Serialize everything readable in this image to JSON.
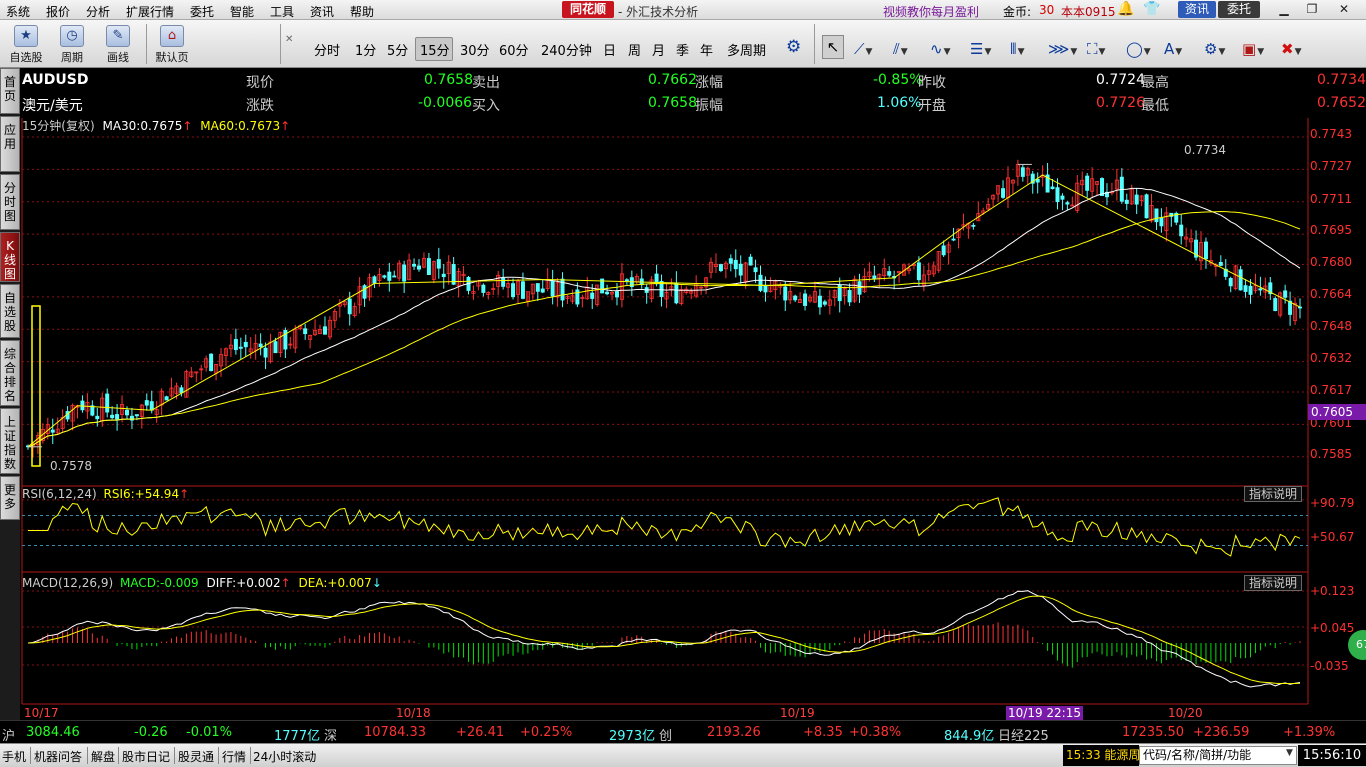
{
  "menu": [
    "系统",
    "报价",
    "分析",
    "扩展行情",
    "委托",
    "智能",
    "工具",
    "资讯",
    "帮助"
  ],
  "app": {
    "brand": "同花顺",
    "title": "- 外汇技术分析",
    "promo": "视频教你每月盈利",
    "coins_label": "金币:",
    "coins_value": "30",
    "version": "本本0915"
  },
  "top_buttons": {
    "news": "资讯",
    "trade": "委托"
  },
  "toolbar": {
    "self_select": "自选股",
    "cycle": "周期",
    "draw": "画线",
    "default_page": "默认页",
    "periods": [
      "分时",
      "1分",
      "5分",
      "15分",
      "30分",
      "60分",
      "240分钟",
      "日",
      "周",
      "月",
      "季",
      "年",
      "多周期"
    ],
    "active_period": "15分"
  },
  "sidebar": {
    "tabs": [
      "首页",
      "应用",
      "分时图",
      "K线图",
      "自选股",
      "综合排名",
      "上证指数",
      "更多"
    ],
    "active": "K线图"
  },
  "quote": {
    "symbol": "AUDUSD",
    "name": "澳元/美元",
    "now_label": "现价",
    "now": "0.7658",
    "change_label": "涨跌",
    "change": "-0.0066",
    "sell_label": "卖出",
    "sell": "0.7662",
    "buy_label": "买入",
    "buy": "0.7658",
    "pct_label": "涨幅",
    "pct": "-0.85%",
    "amp_label": "振幅",
    "amp": "1.06%",
    "prev_label": "昨收",
    "prev": "0.7724",
    "open_label": "开盘",
    "open": "0.7726",
    "high_label": "最高",
    "high": "0.7734",
    "low_label": "最低",
    "low": "0.7652"
  },
  "ma_line": {
    "period": "15分钟(复权)",
    "ma30_label": "MA30:",
    "ma30": "0.7675",
    "ma60_label": "MA60:",
    "ma60": "0.7673"
  },
  "rsi": {
    "label": "RSI(6,12,24)",
    "rsi6_label": "RSI6:",
    "rsi6": "+54.94",
    "explain": "指标说明",
    "levels": [
      "+90.79",
      "+50.67"
    ]
  },
  "macd": {
    "label": "MACD(12,26,9)",
    "macd_label": "MACD:",
    "macd": "-0.009",
    "diff_label": "DIFF:",
    "diff": "+0.002",
    "dea_label": "DEA:",
    "dea": "+0.007",
    "explain": "指标说明",
    "levels": [
      "+0.123",
      "+0.045",
      "-0.035"
    ]
  },
  "price_axis": [
    "0.7743",
    "0.7727",
    "0.7711",
    "0.7695",
    "0.7680",
    "0.7664",
    "0.7648",
    "0.7632",
    "0.7617",
    "0.7601",
    "0.7585"
  ],
  "current_price_tag": "0.7605",
  "annotations": {
    "high": "0.7734",
    "low": "0.7578"
  },
  "x_dates": [
    "10/17",
    "10/18",
    "10/19",
    "10/19 22:15",
    "10/20"
  ],
  "colors": {
    "up": "#ff3232",
    "down": "#54ffff",
    "ma30": "#ffffff",
    "ma60": "#ffff00",
    "rsi": "#ffff00",
    "macd_pos": "#ff3232",
    "macd_neg": "#00e000"
  },
  "chart_data": {
    "type": "candlestick",
    "title": "AUDUSD 15分钟(复权)",
    "ylim": [
      0.7572,
      0.7745
    ],
    "x_sessions": [
      "10/17",
      "10/18",
      "10/19",
      "10/20"
    ],
    "close_path": [
      [
        0,
        0.759
      ],
      [
        10,
        0.7612
      ],
      [
        20,
        0.7605
      ],
      [
        30,
        0.762
      ],
      [
        40,
        0.7638
      ],
      [
        50,
        0.764
      ],
      [
        60,
        0.765
      ],
      [
        70,
        0.767
      ],
      [
        80,
        0.7682
      ],
      [
        90,
        0.7672
      ],
      [
        100,
        0.7668
      ],
      [
        110,
        0.7666
      ],
      [
        120,
        0.767
      ],
      [
        130,
        0.7665
      ],
      [
        140,
        0.768
      ],
      [
        150,
        0.767
      ],
      [
        160,
        0.766
      ],
      [
        170,
        0.7672
      ],
      [
        180,
        0.7675
      ],
      [
        190,
        0.77
      ],
      [
        200,
        0.7725
      ],
      [
        210,
        0.7715
      ],
      [
        220,
        0.7718
      ],
      [
        230,
        0.77
      ],
      [
        240,
        0.768
      ],
      [
        250,
        0.7664
      ],
      [
        257,
        0.7658
      ]
    ],
    "series": [
      {
        "name": "MA30",
        "last": 0.7675
      },
      {
        "name": "MA60",
        "last": 0.7673
      }
    ]
  },
  "status": {
    "sh_label": "沪",
    "sh": "3084.46",
    "sh_chg": "-0.26",
    "sh_pct": "-0.01%",
    "sh_amt": "1777亿",
    "sz_label": "深",
    "sz": "10784.33",
    "sz_chg": "+26.41",
    "sz_pct": "+0.25%",
    "sz_amt": "2973亿",
    "cy_label": "创",
    "cy": "2193.26",
    "cy_chg": "+8.35",
    "cy_pct": "+0.38%",
    "cy_amt": "844.9亿",
    "nk_label": "日经225",
    "nk": "17235.50",
    "nk_chg": "+236.59",
    "nk_pct": "+1.39%"
  },
  "bottom": {
    "items": [
      "手机",
      "机器问答",
      "解盘",
      "股市日记",
      "股灵通",
      "行情",
      "24小时滚动"
    ],
    "ticker": "15:33 能源周",
    "search": "代码/名称/简拼/功能",
    "clock": "15:56:10"
  }
}
